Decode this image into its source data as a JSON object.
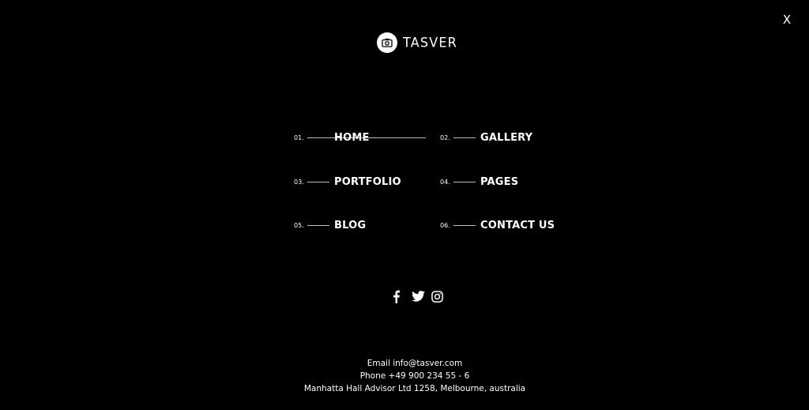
{
  "close": {
    "label": "X"
  },
  "brand": {
    "name": "TASVER",
    "icon": "camera-icon"
  },
  "menu": [
    {
      "number": "01.",
      "label": "HOME",
      "active": true
    },
    {
      "number": "02.",
      "label": "GALLERY",
      "active": false
    },
    {
      "number": "03.",
      "label": "PORTFOLIO",
      "active": false
    },
    {
      "number": "04.",
      "label": "PAGES",
      "active": false
    },
    {
      "number": "05.",
      "label": "BLOG",
      "active": false
    },
    {
      "number": "06.",
      "label": "CONTACT US",
      "active": false
    }
  ],
  "social": [
    {
      "icon": "facebook-icon"
    },
    {
      "icon": "twitter-icon"
    },
    {
      "icon": "instagram-icon"
    }
  ],
  "contact": {
    "email": "Email info@tasver.com",
    "phone": "Phone +49 900 234 55 - 6",
    "address": "Manhatta Hall Advisor Ltd 1258, Melbourne, australia"
  },
  "colors": {
    "background": "#000000",
    "text": "#ffffff",
    "line": "#bdbdbd"
  }
}
